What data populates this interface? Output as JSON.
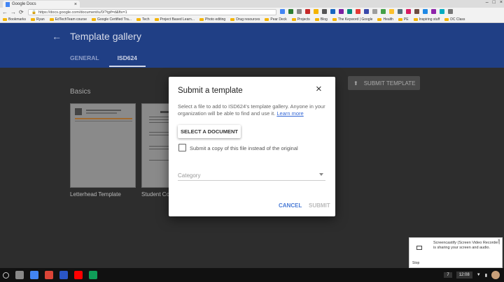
{
  "browser": {
    "tab_title": "Google Docs",
    "url": "https://docs.google.com/document/u/0/?tgif=d&ftv=1",
    "bookmarks": [
      "Bookmarks",
      "Ryan",
      "EdTechTeam course",
      "Google Certified Tra...",
      "Tech",
      "Project Based Learn...",
      "Photo editing",
      "Drug resources",
      "Pear Deck",
      "Projects",
      "Blog",
      "The Keyword | Google",
      "Health",
      "PE",
      "Inspiring stuff",
      "DC Class"
    ],
    "extension_colors": [
      "#4285f4",
      "#2e7d32",
      "#888888",
      "#c62828",
      "#f4b400",
      "#555555",
      "#1565c0",
      "#7b1fa2",
      "#00897b",
      "#e53935",
      "#3949ab",
      "#9e9e9e",
      "#43a047",
      "#fbc02d",
      "#546e7a",
      "#d81b60",
      "#6d4c41",
      "#1e88e5",
      "#8e24aa",
      "#00acc1",
      "#757575"
    ]
  },
  "header": {
    "title": "Template gallery",
    "tabs": [
      {
        "label": "GENERAL"
      },
      {
        "label": "ISD624"
      }
    ]
  },
  "page": {
    "section_title": "Basics",
    "submit_template_label": "SUBMIT TEMPLATE",
    "cards": [
      {
        "label": "Letterhead Template"
      },
      {
        "label": "Student Co"
      }
    ]
  },
  "dialog": {
    "title": "Submit a template",
    "description": "Select a file to add to ISD624's template gallery. Anyone in your organization will be able to find and use it.",
    "learn_more": "Learn more",
    "select_document_label": "SELECT A DOCUMENT",
    "copy_checkbox_label": "Submit a copy of this file instead of the original",
    "copy_checked": false,
    "category_placeholder": "Category",
    "cancel_label": "CANCEL",
    "submit_label": "SUBMIT"
  },
  "notification": {
    "text": "Screencastify (Screen Video Recorder) is sharing your screen and audio.",
    "stop_label": "Stop"
  },
  "taskbar": {
    "badge": "7",
    "time": "12:08",
    "app_colors": [
      "#888888",
      "#4285f4",
      "#db4437",
      "#2a56c6",
      "#ff0000",
      "#0f9d58"
    ]
  },
  "colors": {
    "header_bg": "#203f85",
    "accent": "#3367d6"
  }
}
